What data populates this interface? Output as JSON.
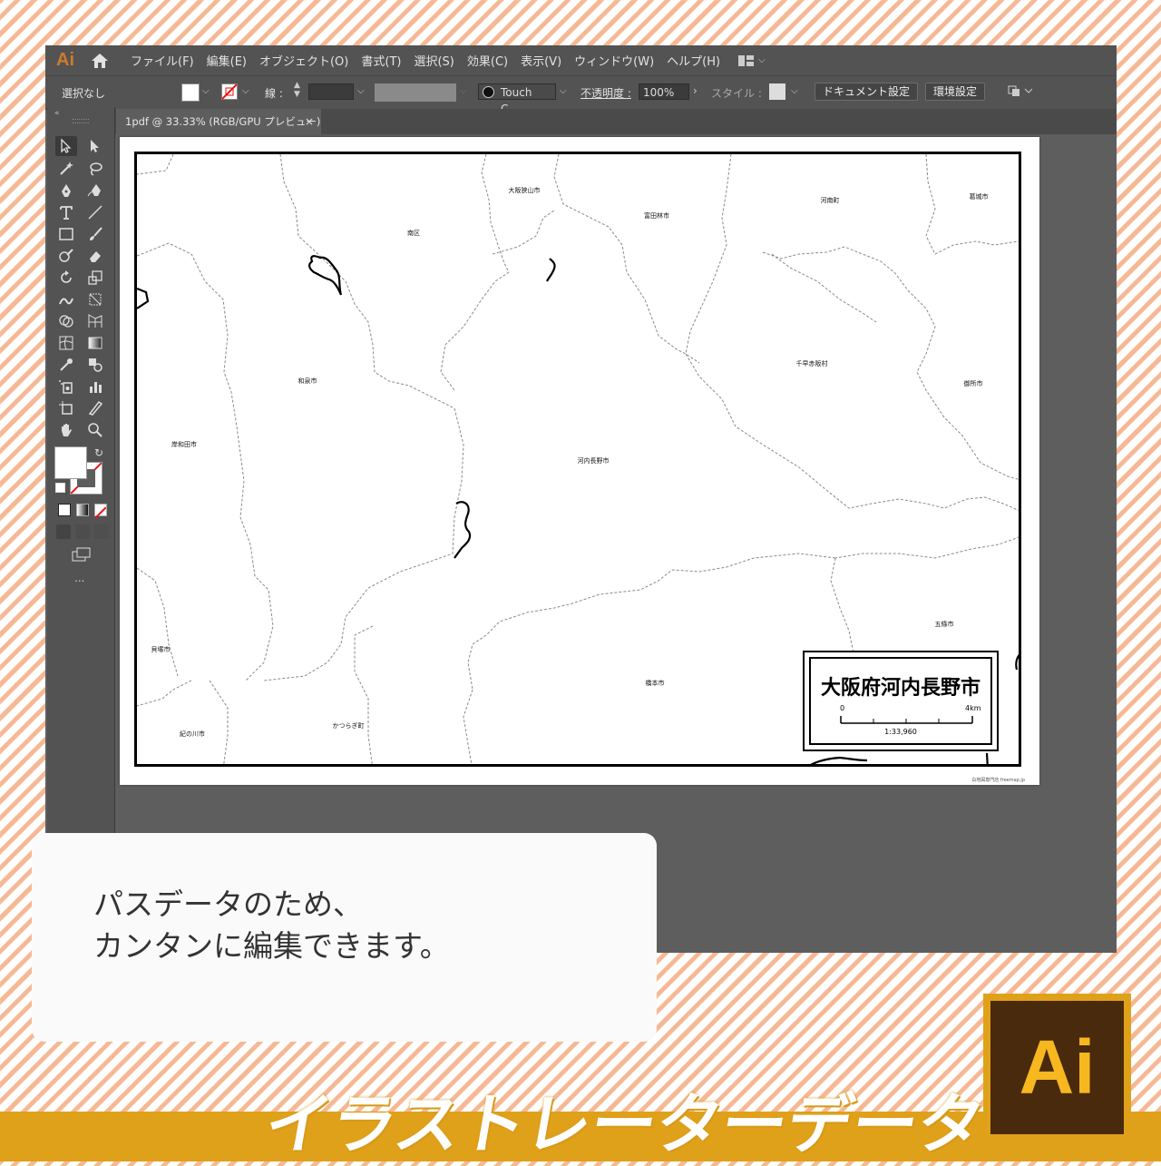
{
  "app": {
    "logo": "Ai",
    "menus": [
      "ファイル(F)",
      "編集(E)",
      "オブジェクト(O)",
      "書式(T)",
      "選択(S)",
      "効果(C)",
      "表示(V)",
      "ウィンドウ(W)",
      "ヘルプ(H)"
    ]
  },
  "control_bar": {
    "selection": "選択なし",
    "stroke_label": "線 :",
    "brush": "Touch C...",
    "opacity_label": "不透明度 :",
    "opacity_value": "100%",
    "style_label": "スタイル :",
    "doc_settings_button": "ドキュメント設定",
    "prefs_button": "環境設定"
  },
  "document_tab": {
    "title": "1pdf @ 33.33% (RGB/GPU プレビュー)",
    "close": "×"
  },
  "toolbar": {
    "more": "..."
  },
  "map": {
    "places": [
      {
        "name": "大阪狭山市"
      },
      {
        "name": "富田林市"
      },
      {
        "name": "河南町"
      },
      {
        "name": "葛城市"
      },
      {
        "name": "南区"
      },
      {
        "name": "千早赤阪村"
      },
      {
        "name": "和泉市"
      },
      {
        "name": "御所市"
      },
      {
        "name": "岸和田市"
      },
      {
        "name": "河内長野市"
      },
      {
        "name": "五條市"
      },
      {
        "name": "貝塚市"
      },
      {
        "name": "橋本市"
      },
      {
        "name": "かつらぎ町"
      },
      {
        "name": "紀の川市"
      }
    ],
    "title": "大阪府河内長野市",
    "scale_start": "0",
    "scale_end": "4km",
    "scale_ratio": "1:33,960",
    "credit": "白地図専門店 freemap.jp"
  },
  "caption": {
    "line1": "パスデータのため、",
    "line2": "カンタンに編集できます。"
  },
  "banner": {
    "title": "イラストレーターデータ"
  },
  "badge": {
    "text": "Ai"
  },
  "colors": {
    "stripe": "#f6b894",
    "band": "#e0a11a",
    "ui_dark": "#535353",
    "canvas": "#5e5e5e",
    "logo_brown": "#4a2a0c"
  }
}
